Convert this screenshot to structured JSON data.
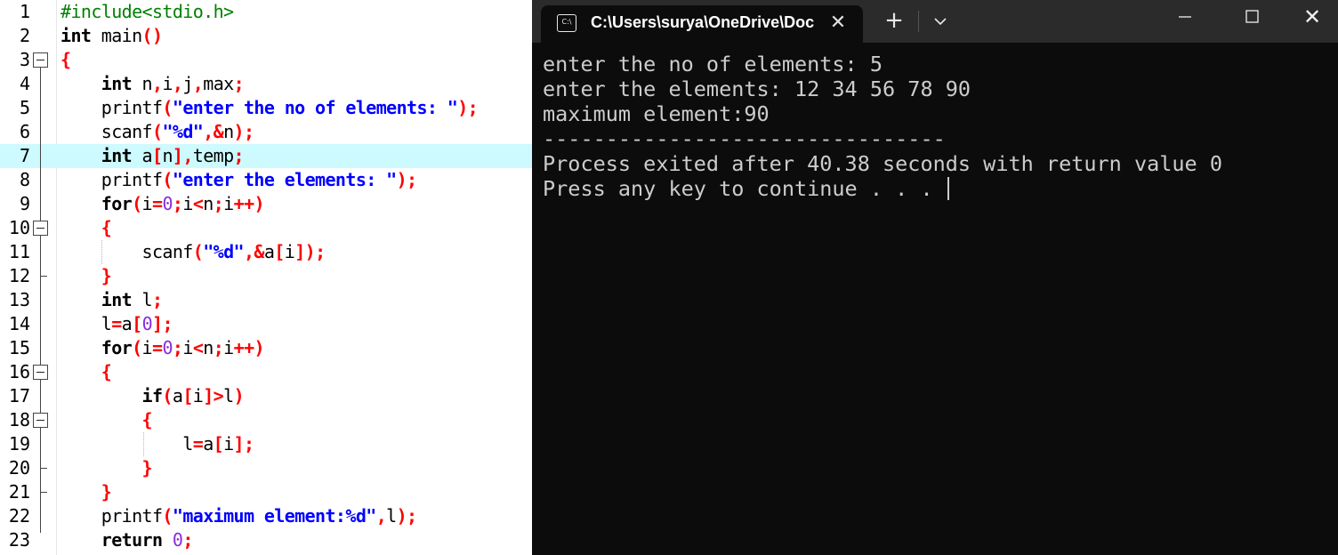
{
  "editor": {
    "current_line": 7,
    "lines": [
      {
        "n": "1",
        "tokens": [
          {
            "t": "#include<stdio.h>",
            "c": "pp"
          }
        ]
      },
      {
        "n": "2",
        "tokens": [
          {
            "t": "int",
            "c": "kw"
          },
          {
            "t": " main",
            "c": "plain"
          },
          {
            "t": "()",
            "c": "sym"
          }
        ]
      },
      {
        "n": "3",
        "tokens": [
          {
            "t": "{",
            "c": "sym"
          }
        ]
      },
      {
        "n": "4",
        "tokens": [
          {
            "t": "    ",
            "c": "plain"
          },
          {
            "t": "int",
            "c": "kw"
          },
          {
            "t": " n",
            "c": "plain"
          },
          {
            "t": ",",
            "c": "sym"
          },
          {
            "t": "i",
            "c": "plain"
          },
          {
            "t": ",",
            "c": "sym"
          },
          {
            "t": "j",
            "c": "plain"
          },
          {
            "t": ",",
            "c": "sym"
          },
          {
            "t": "max",
            "c": "plain"
          },
          {
            "t": ";",
            "c": "sym"
          }
        ]
      },
      {
        "n": "5",
        "tokens": [
          {
            "t": "    printf",
            "c": "plain"
          },
          {
            "t": "(",
            "c": "sym"
          },
          {
            "t": "\"enter the no of elements: \"",
            "c": "str"
          },
          {
            "t": ");",
            "c": "sym"
          }
        ]
      },
      {
        "n": "6",
        "tokens": [
          {
            "t": "    scanf",
            "c": "plain"
          },
          {
            "t": "(",
            "c": "sym"
          },
          {
            "t": "\"%d\"",
            "c": "str"
          },
          {
            "t": ",&",
            "c": "sym"
          },
          {
            "t": "n",
            "c": "plain"
          },
          {
            "t": ");",
            "c": "sym"
          }
        ]
      },
      {
        "n": "7",
        "tokens": [
          {
            "t": "    ",
            "c": "plain"
          },
          {
            "t": "int",
            "c": "kw"
          },
          {
            "t": " a",
            "c": "plain"
          },
          {
            "t": "[",
            "c": "sym"
          },
          {
            "t": "n",
            "c": "plain"
          },
          {
            "t": "],",
            "c": "sym"
          },
          {
            "t": "temp",
            "c": "plain"
          },
          {
            "t": ";",
            "c": "sym"
          }
        ]
      },
      {
        "n": "8",
        "tokens": [
          {
            "t": "    printf",
            "c": "plain"
          },
          {
            "t": "(",
            "c": "sym"
          },
          {
            "t": "\"enter the elements: \"",
            "c": "str"
          },
          {
            "t": ");",
            "c": "sym"
          }
        ]
      },
      {
        "n": "9",
        "tokens": [
          {
            "t": "    ",
            "c": "plain"
          },
          {
            "t": "for",
            "c": "kw"
          },
          {
            "t": "(",
            "c": "sym"
          },
          {
            "t": "i",
            "c": "plain"
          },
          {
            "t": "=",
            "c": "sym"
          },
          {
            "t": "0",
            "c": "num"
          },
          {
            "t": ";",
            "c": "sym"
          },
          {
            "t": "i",
            "c": "plain"
          },
          {
            "t": "<",
            "c": "sym"
          },
          {
            "t": "n",
            "c": "plain"
          },
          {
            "t": ";",
            "c": "sym"
          },
          {
            "t": "i",
            "c": "plain"
          },
          {
            "t": "++)",
            "c": "sym"
          }
        ]
      },
      {
        "n": "10",
        "tokens": [
          {
            "t": "    ",
            "c": "plain"
          },
          {
            "t": "{",
            "c": "sym"
          }
        ]
      },
      {
        "n": "11",
        "tokens": [
          {
            "t": "        scanf",
            "c": "plain"
          },
          {
            "t": "(",
            "c": "sym"
          },
          {
            "t": "\"%d\"",
            "c": "str"
          },
          {
            "t": ",&",
            "c": "sym"
          },
          {
            "t": "a",
            "c": "plain"
          },
          {
            "t": "[",
            "c": "sym"
          },
          {
            "t": "i",
            "c": "plain"
          },
          {
            "t": "]);",
            "c": "sym"
          }
        ]
      },
      {
        "n": "12",
        "tokens": [
          {
            "t": "    ",
            "c": "plain"
          },
          {
            "t": "}",
            "c": "sym"
          }
        ]
      },
      {
        "n": "13",
        "tokens": [
          {
            "t": "    ",
            "c": "plain"
          },
          {
            "t": "int",
            "c": "kw"
          },
          {
            "t": " l",
            "c": "plain"
          },
          {
            "t": ";",
            "c": "sym"
          }
        ]
      },
      {
        "n": "14",
        "tokens": [
          {
            "t": "    l",
            "c": "plain"
          },
          {
            "t": "=",
            "c": "sym"
          },
          {
            "t": "a",
            "c": "plain"
          },
          {
            "t": "[",
            "c": "sym"
          },
          {
            "t": "0",
            "c": "num"
          },
          {
            "t": "];",
            "c": "sym"
          }
        ]
      },
      {
        "n": "15",
        "tokens": [
          {
            "t": "    ",
            "c": "plain"
          },
          {
            "t": "for",
            "c": "kw"
          },
          {
            "t": "(",
            "c": "sym"
          },
          {
            "t": "i",
            "c": "plain"
          },
          {
            "t": "=",
            "c": "sym"
          },
          {
            "t": "0",
            "c": "num"
          },
          {
            "t": ";",
            "c": "sym"
          },
          {
            "t": "i",
            "c": "plain"
          },
          {
            "t": "<",
            "c": "sym"
          },
          {
            "t": "n",
            "c": "plain"
          },
          {
            "t": ";",
            "c": "sym"
          },
          {
            "t": "i",
            "c": "plain"
          },
          {
            "t": "++)",
            "c": "sym"
          }
        ]
      },
      {
        "n": "16",
        "tokens": [
          {
            "t": "    ",
            "c": "plain"
          },
          {
            "t": "{",
            "c": "sym"
          }
        ]
      },
      {
        "n": "17",
        "tokens": [
          {
            "t": "        ",
            "c": "plain"
          },
          {
            "t": "if",
            "c": "kw"
          },
          {
            "t": "(",
            "c": "sym"
          },
          {
            "t": "a",
            "c": "plain"
          },
          {
            "t": "[",
            "c": "sym"
          },
          {
            "t": "i",
            "c": "plain"
          },
          {
            "t": "]>",
            "c": "sym"
          },
          {
            "t": "l",
            "c": "plain"
          },
          {
            "t": ")",
            "c": "sym"
          }
        ]
      },
      {
        "n": "18",
        "tokens": [
          {
            "t": "        ",
            "c": "plain"
          },
          {
            "t": "{",
            "c": "sym"
          }
        ]
      },
      {
        "n": "19",
        "tokens": [
          {
            "t": "            l",
            "c": "plain"
          },
          {
            "t": "=",
            "c": "sym"
          },
          {
            "t": "a",
            "c": "plain"
          },
          {
            "t": "[",
            "c": "sym"
          },
          {
            "t": "i",
            "c": "plain"
          },
          {
            "t": "];",
            "c": "sym"
          }
        ]
      },
      {
        "n": "20",
        "tokens": [
          {
            "t": "        ",
            "c": "plain"
          },
          {
            "t": "}",
            "c": "sym"
          }
        ]
      },
      {
        "n": "21",
        "tokens": [
          {
            "t": "    ",
            "c": "plain"
          },
          {
            "t": "}",
            "c": "sym"
          }
        ]
      },
      {
        "n": "22",
        "tokens": [
          {
            "t": "    printf",
            "c": "plain"
          },
          {
            "t": "(",
            "c": "sym"
          },
          {
            "t": "\"maximum element:%d\"",
            "c": "str"
          },
          {
            "t": ",",
            "c": "sym"
          },
          {
            "t": "l",
            "c": "plain"
          },
          {
            "t": ");",
            "c": "sym"
          }
        ]
      },
      {
        "n": "23",
        "tokens": [
          {
            "t": "    ",
            "c": "plain"
          },
          {
            "t": "return",
            "c": "kw"
          },
          {
            "t": " ",
            "c": "plain"
          },
          {
            "t": "0",
            "c": "num"
          },
          {
            "t": ";",
            "c": "sym"
          }
        ]
      }
    ]
  },
  "terminal": {
    "tab_title": "C:\\Users\\surya\\OneDrive\\Doc",
    "tab_icon_text": "C:\\",
    "close_tab_glyph": "✕",
    "new_tab_glyph": "+",
    "window_close_glyph": "✕",
    "output": [
      "enter the no of elements: 5",
      "enter the elements: 12 34 56 78 90",
      "maximum element:90",
      "--------------------------------",
      "Process exited after 40.38 seconds with return value 0",
      "Press any key to continue . . . "
    ]
  },
  "colors": {
    "keyword": "#000000",
    "preprocessor": "#008000",
    "string": "#0000ff",
    "symbol": "#ff0000",
    "number": "#8a2be2",
    "current_line_bg": "#ccfaff",
    "terminal_bg": "#0c0c0c",
    "terminal_fg": "#cccccc",
    "titlebar_bg": "#2b2b2b"
  },
  "icons": [
    "terminal-icon",
    "close-icon",
    "plus-icon",
    "chevron-down-icon",
    "minimize-icon",
    "maximize-icon",
    "window-close-icon",
    "fold-toggle-icon"
  ]
}
